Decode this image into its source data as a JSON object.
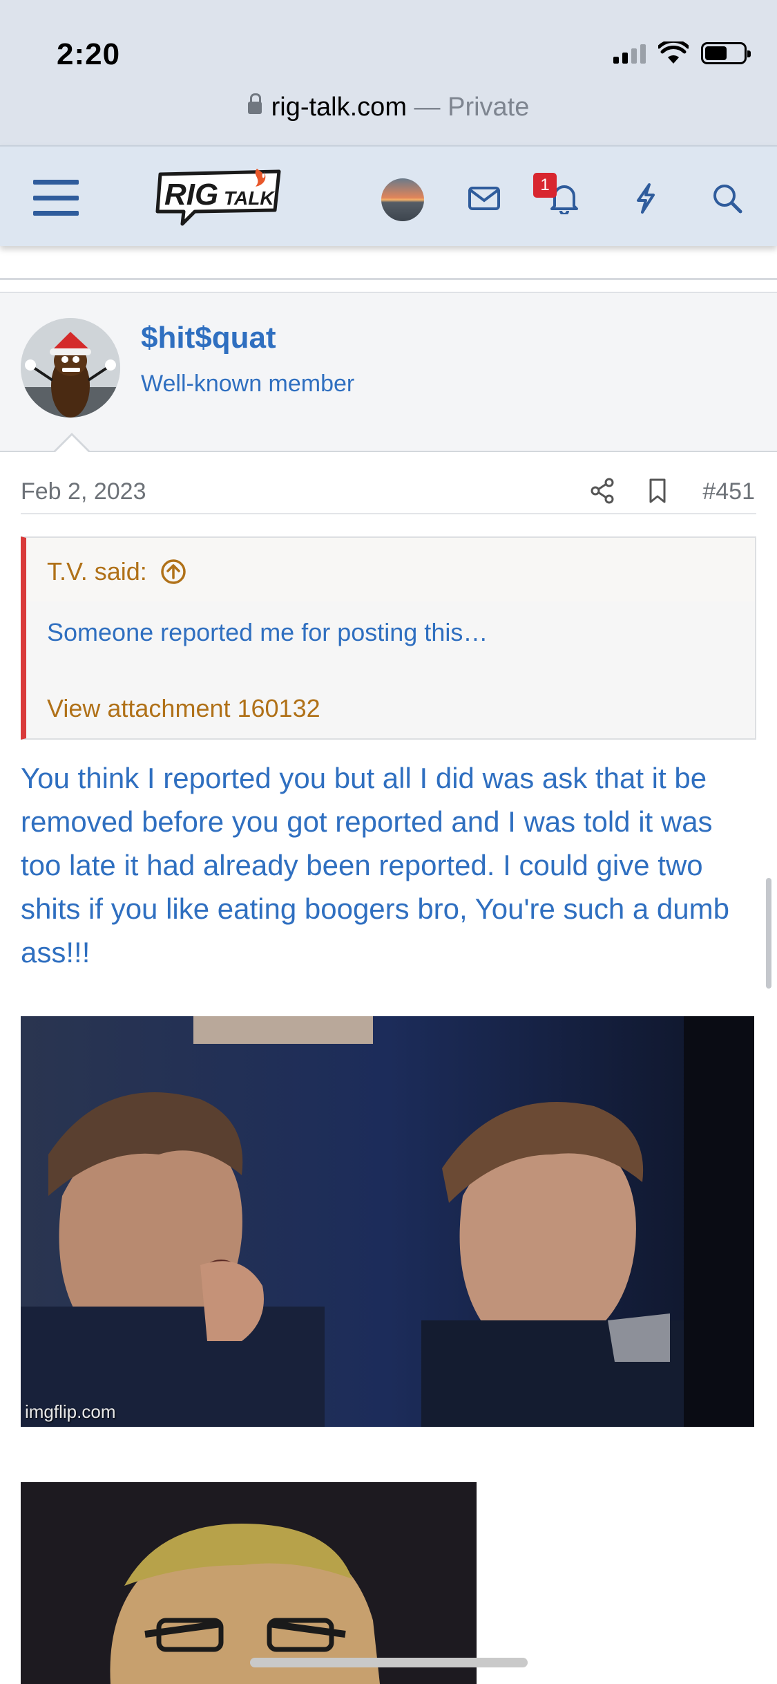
{
  "status_bar": {
    "time": "2:20"
  },
  "browser": {
    "domain": "rig-talk.com",
    "separator": " — ",
    "privacy": "Private"
  },
  "header": {
    "logo_main": "RIG",
    "logo_sub": "TALK",
    "notification_count": "1"
  },
  "post": {
    "author": "$hit$quat",
    "member_title": "Well-known member",
    "date": "Feb 2, 2023",
    "post_number": "#451",
    "quote": {
      "author": "T.V. said:",
      "text": "Someone reported me for posting this…",
      "attachment": "View attachment 160132"
    },
    "body": "You think I reported you but all I did was ask that it be removed before you got reported and I was told it was too late it had already been reported. I could give two shits if you like eating boogers bro, You're such a dumb ass!!!",
    "media_watermark": "imgflip.com"
  },
  "colors": {
    "link_blue": "#2f6fc0",
    "quote_gold": "#b07118",
    "quote_border": "#d93a3a",
    "badge_red": "#d8262f",
    "header_bg": "#dde6f1"
  }
}
